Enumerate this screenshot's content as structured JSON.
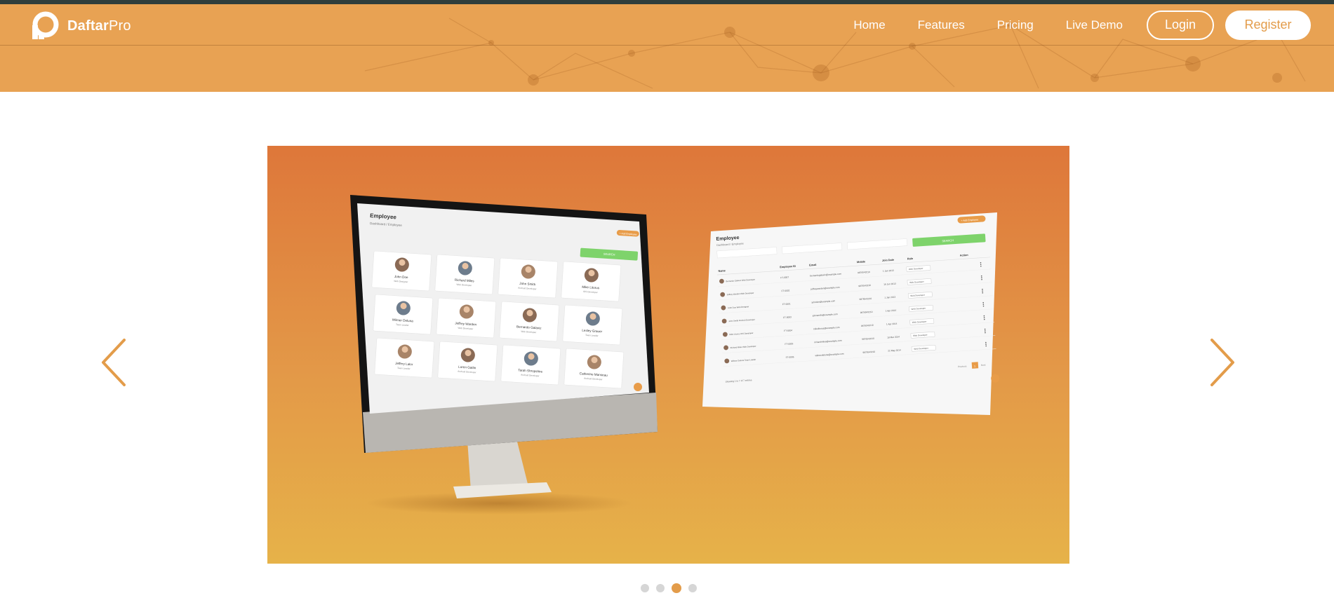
{
  "brand": {
    "name_bold": "Daftar",
    "name_rest": "Pro"
  },
  "nav": {
    "links": [
      "Home",
      "Features",
      "Pricing",
      "Live Demo"
    ],
    "login_label": "Login",
    "register_label": "Register"
  },
  "colors": {
    "brand_orange": "#e8a253",
    "accent": "#e39c4a",
    "top_strip": "#2f3e3c",
    "slide_gradient_top": "#de773a",
    "slide_gradient_bottom": "#e6b249",
    "mock_green": "#7ed36b"
  },
  "slider": {
    "slide_count": 4,
    "active_index": 2,
    "prev_icon": "chevron-left-icon",
    "next_icon": "chevron-right-icon"
  },
  "mock_monitor": {
    "title": "Employee",
    "breadcrumb": "Dashboard / Employee",
    "add_button": "+ Add Employee",
    "search_button": "SEARCH",
    "employees": [
      {
        "name": "John Doe",
        "role": "Web Designer"
      },
      {
        "name": "Richard Miles",
        "role": "Web Developer"
      },
      {
        "name": "John Smith",
        "role": "Android Developer"
      },
      {
        "name": "Mike Litorus",
        "role": "IOS Developer"
      },
      {
        "name": "Wilmer Deluna",
        "role": "Team Leader"
      },
      {
        "name": "Jeffrey Warden",
        "role": "Web Developer"
      },
      {
        "name": "Bernardo Galaviz",
        "role": "Web Developer"
      },
      {
        "name": "Lesley Grauer",
        "role": "Team Leader"
      },
      {
        "name": "Jeffery Lalor",
        "role": "Team Leader"
      },
      {
        "name": "Loren Gatlin",
        "role": "Android Developer"
      },
      {
        "name": "Tarah Shropshire",
        "role": "Android Developer"
      },
      {
        "name": "Catherine Manseau",
        "role": "Android Developer"
      }
    ]
  },
  "mock_table": {
    "title": "Employee",
    "breadcrumb": "Dashboard / Employee",
    "add_button": "+ Add Employee",
    "search_button": "SEARCH",
    "columns": [
      "Name",
      "Employee ID",
      "Email",
      "Mobile",
      "Join Date",
      "Role",
      "Action"
    ],
    "rows": [
      {
        "name": "Bernardo Galaviz Web Developer",
        "id": "FT-0007",
        "email": "bernardogalaviz@example.com",
        "mobile": "9876543210",
        "join": "1 Jan 2013",
        "role": "Web Developer"
      },
      {
        "name": "Jeffrey Warden Web Developer",
        "id": "FT-0002",
        "email": "jeffreywarden@example.com",
        "mobile": "9876543210",
        "join": "16 Jun 2013",
        "role": "Web Developer"
      },
      {
        "name": "John Doe Web Designer",
        "id": "FT-0001",
        "email": "johndoe@example.com",
        "mobile": "9876543210",
        "join": "1 Jan 2013",
        "role": "Web Developer"
      },
      {
        "name": "John Smith Android Developer",
        "id": "FT-0003",
        "email": "johnsmith@example.com",
        "mobile": "9876543210",
        "join": "1 Apr 2014",
        "role": "Web Developer"
      },
      {
        "name": "Mike Litorus IOS Developer",
        "id": "FT-0004",
        "email": "mikelitorus@example.com",
        "mobile": "9876543210",
        "join": "1 Apr 2014",
        "role": "Web Developer"
      },
      {
        "name": "Richard Miles Web Developer",
        "id": "FT-0005",
        "email": "richardmiles@example.com",
        "mobile": "9876543210",
        "join": "18 Mar 2014",
        "role": "Web Developer"
      },
      {
        "name": "Wilmer Deluna Team Leader",
        "id": "FT-0006",
        "email": "wilmerdeluna@example.com",
        "mobile": "9876543210",
        "join": "22 May 2014",
        "role": "Web Developer"
      }
    ],
    "footer": "Showing 1 to 7 of 7 entries",
    "prev": "Previous",
    "page": "1",
    "next": "Next"
  }
}
